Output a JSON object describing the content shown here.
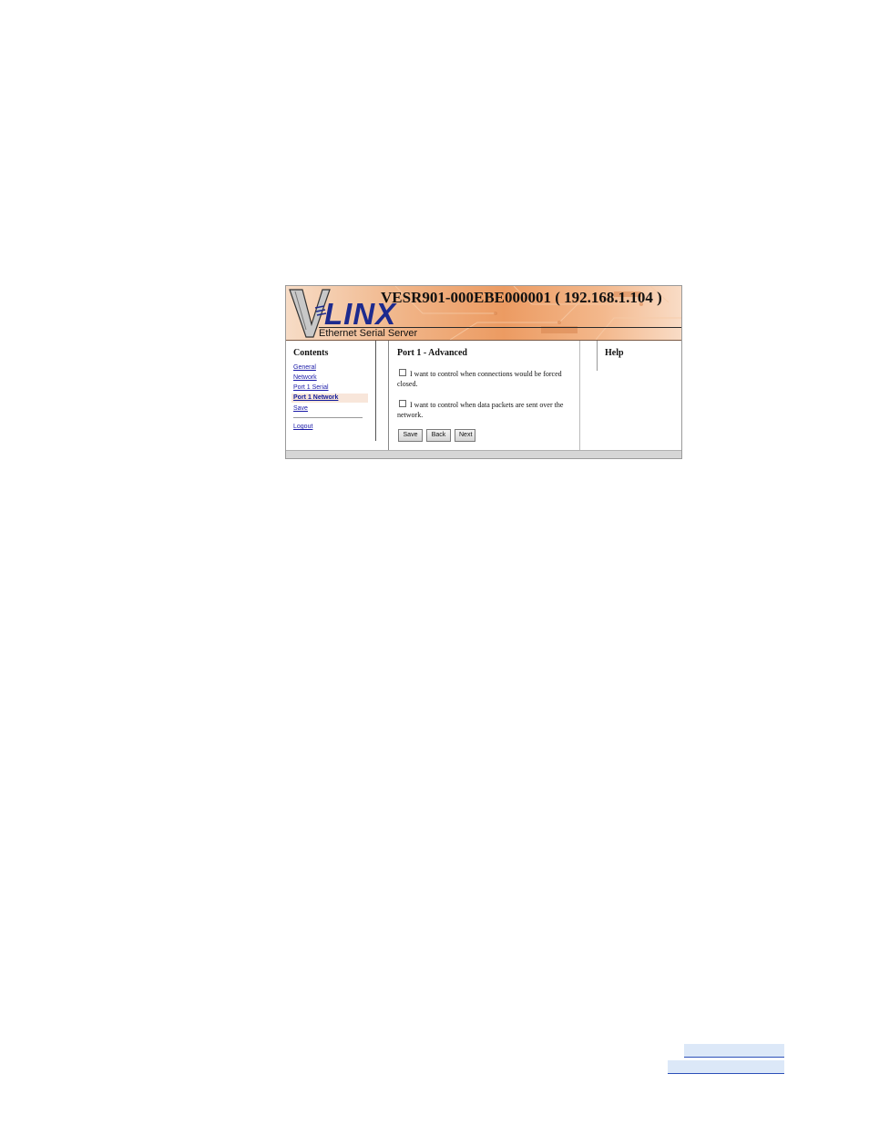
{
  "banner": {
    "title": "VESR901-000EBE000001 ( 192.168.1.104 )",
    "logo_text": "LINX",
    "subtitle": "Ethernet Serial Server"
  },
  "sidebar": {
    "heading": "Contents",
    "items": [
      {
        "label": "General"
      },
      {
        "label": "Network"
      },
      {
        "label": "Port 1 Serial"
      },
      {
        "label": "Port 1 Network",
        "active": true
      },
      {
        "label": "Save"
      }
    ],
    "logout": "Logout"
  },
  "main": {
    "heading": "Port 1 - Advanced",
    "option1": "I want to control when connections would be forced closed.",
    "option2": "I want to control when data packets are sent over the network.",
    "buttons": {
      "save": "Save",
      "back": "Back",
      "next": "Next"
    }
  },
  "help": {
    "heading": "Help"
  },
  "colors": {
    "link": "#1a1aa8",
    "banner_accent": "#ec9b62",
    "logo": "#1d2a8e"
  }
}
